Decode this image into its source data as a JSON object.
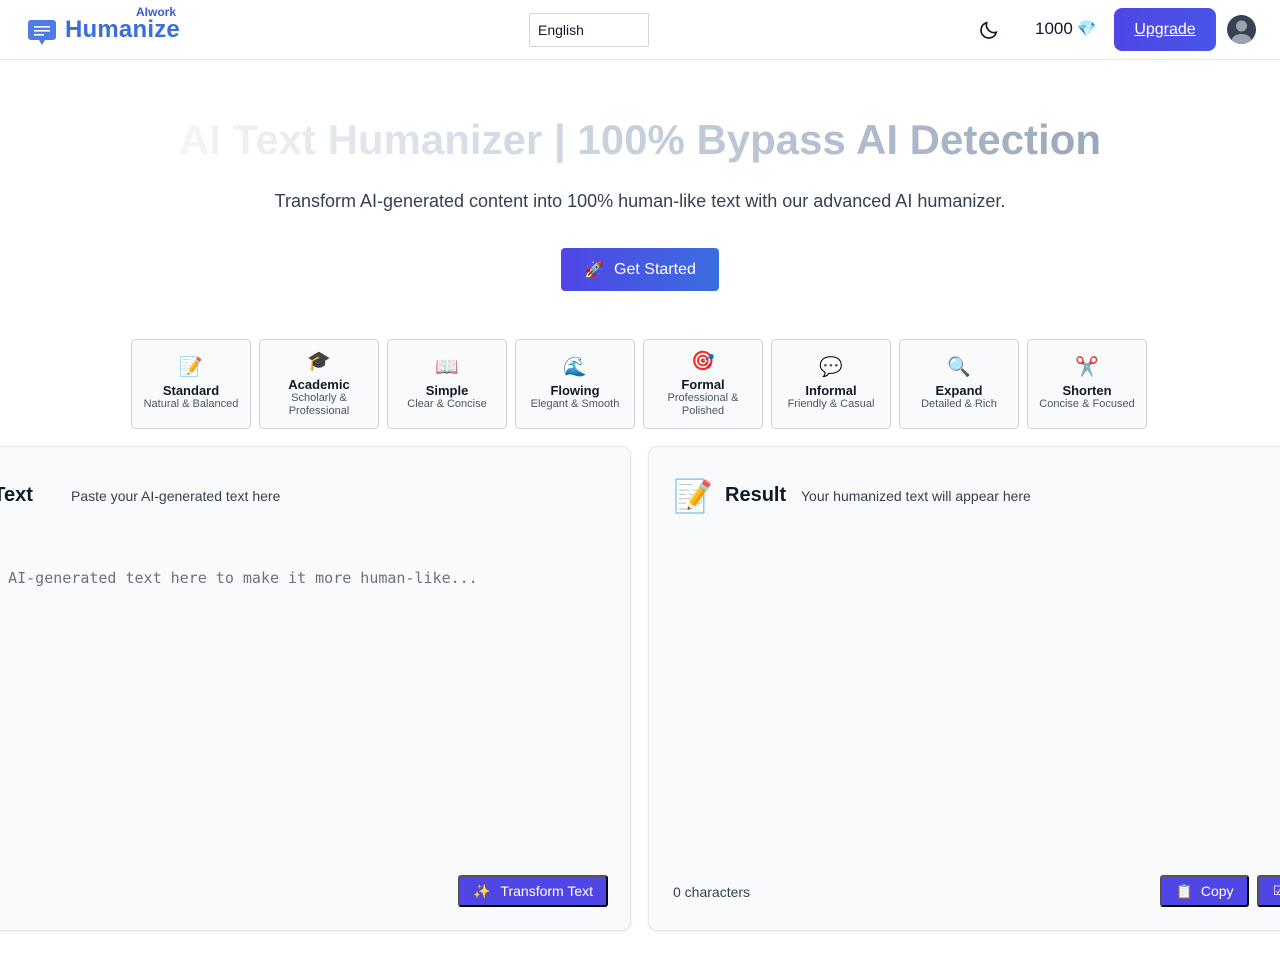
{
  "header": {
    "brand_small": "AIwork",
    "brand_main": "Humanize",
    "language": "English",
    "credits": "1000",
    "credits_icon": "💎",
    "upgrade_label": "Upgrade"
  },
  "hero": {
    "title": "AI Text Humanizer | 100% Bypass AI Detection",
    "subtitle": "Transform AI-generated content into 100% human-like text with our advanced AI humanizer.",
    "cta_icon": "🚀",
    "cta_label": "Get Started"
  },
  "modes": [
    {
      "icon": "📝",
      "name": "Standard",
      "desc": "Natural & Balanced"
    },
    {
      "icon": "🎓",
      "name": "Academic",
      "desc": "Scholarly & Professional"
    },
    {
      "icon": "📖",
      "name": "Simple",
      "desc": "Clear & Concise"
    },
    {
      "icon": "🌊",
      "name": "Flowing",
      "desc": "Elegant & Smooth"
    },
    {
      "icon": "🎯",
      "name": "Formal",
      "desc": "Professional & Polished"
    },
    {
      "icon": "💬",
      "name": "Informal",
      "desc": "Friendly & Casual"
    },
    {
      "icon": "🔍",
      "name": "Expand",
      "desc": "Detailed & Rich"
    },
    {
      "icon": "✂️",
      "name": "Shorten",
      "desc": "Concise & Focused"
    }
  ],
  "input_panel": {
    "title": "t Text",
    "hint": "Paste your AI-generated text here",
    "placeholder": "ur AI-generated text here to make it more human-like...",
    "transform_icon": "✨",
    "transform_label": "Transform Text"
  },
  "result_panel": {
    "icon": "📝",
    "title": "Result",
    "hint": "Your humanized text will appear here",
    "char_count": "0 characters",
    "copy_icon": "📋",
    "copy_label": "Copy"
  },
  "colors": {
    "brand": "#3b6ed8",
    "accent": "#4f46e5"
  }
}
